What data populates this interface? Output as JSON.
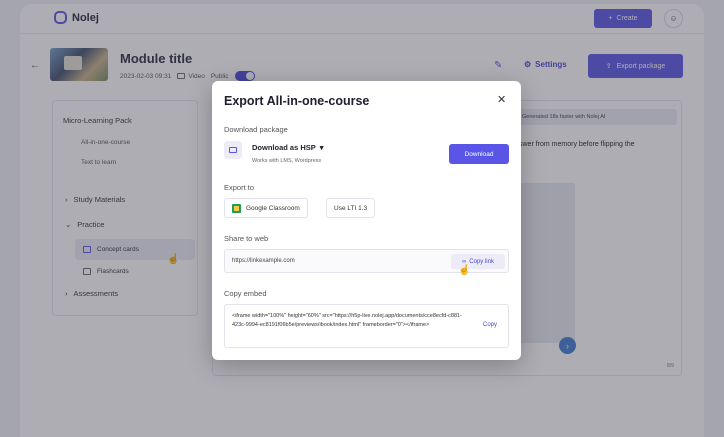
{
  "app": {
    "name": "Nolej",
    "accent": "#5a55e6"
  },
  "topbar": {
    "create_label": "Create"
  },
  "module": {
    "title": "Module title",
    "date": "2023-02-03 09:31",
    "video_label": "Video",
    "public_label": "Public",
    "settings_label": "Settings",
    "export_label": "Export package"
  },
  "sidebar": {
    "heading": "Micro-Learning Pack",
    "items": [
      "All-in-one-course",
      "Text to learn"
    ],
    "study_materials": "Study Materials",
    "practice": "Practice",
    "concept_cards": "Concept cards",
    "flashcards": "Flashcards",
    "assessments": "Assessments"
  },
  "main": {
    "generated_label": "Generated 18s faster with Nolej AI",
    "bg_text": "swer from memory before flipping the",
    "page_num": "8/9"
  },
  "modal": {
    "title": "Export All-in-one-course",
    "download_section": "Download package",
    "hsp_title": "Download as HSP",
    "hsp_sub": "Works with LMS, Wordpress",
    "download_button": "Download",
    "export_section": "Export to",
    "google_classroom": "Google Classroom",
    "lti": "Use LTI 1.3",
    "share_section": "Share to web",
    "url": "https://linkexample.com",
    "copy_link": "Copy link",
    "embed_section": "Copy embed",
    "embed_code": "<iframe width=\"100%\" height=\"60%\" src=\"https://h5p-live.nolej.app/documents/cce8ecfd-c881-423c-9994-ec8191f06b5e/previews/ibook/index.html\" frameborder=\"0\"></iframe>",
    "embed_copy": "Copy"
  }
}
